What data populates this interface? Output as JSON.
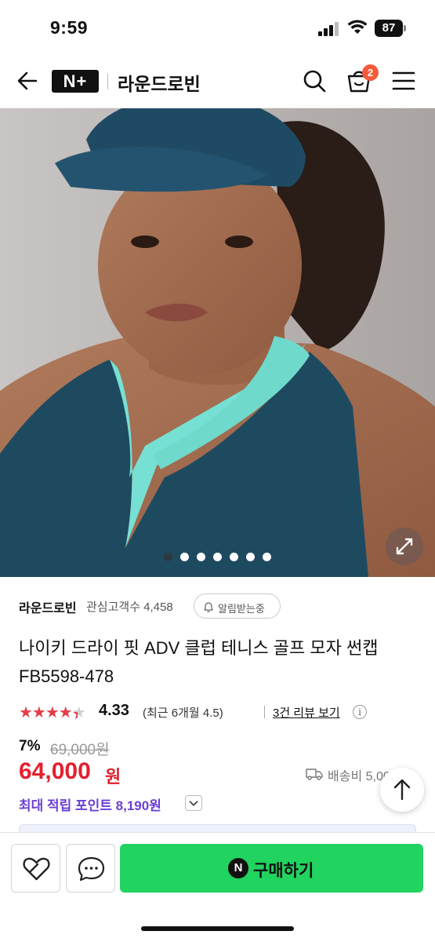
{
  "status_bar": {
    "time": "9:59",
    "battery": "87"
  },
  "header": {
    "logo_text": "N+",
    "store_name": "라운드로빈",
    "cart_count": "2"
  },
  "gallery": {
    "image_alt": "woman wearing navy Nike Dri-FIT visor cap",
    "dots": 7,
    "active_index": 0
  },
  "store": {
    "name": "라운드로빈",
    "fans_label": "관심고객수 4,458",
    "alarm_label": "알림받는중"
  },
  "product": {
    "title_line1": "나이키 드라이 핏 ADV 클럽 테니스 골프 모자 썬캡",
    "title_line2": "FB5598-478"
  },
  "rating": {
    "stars": 4.33,
    "value": "4.33",
    "recent": "(최근 6개월 4.5)",
    "review_link": "3건 리뷰 보기",
    "info": "i"
  },
  "price": {
    "discount": "7%",
    "original": "69,000원",
    "sale": "64,000",
    "sale_unit": "원",
    "shipping": "배송비 5,00",
    "points": "최대 적립 포인트 8,190원"
  },
  "actions": {
    "buy_label": "구매하기",
    "buy_badge": "N"
  },
  "colors": {
    "accent_green": "#21d35f",
    "price_red": "#e3202e",
    "points_purple": "#6b3fd4",
    "badge_orange": "#f35b3b"
  }
}
